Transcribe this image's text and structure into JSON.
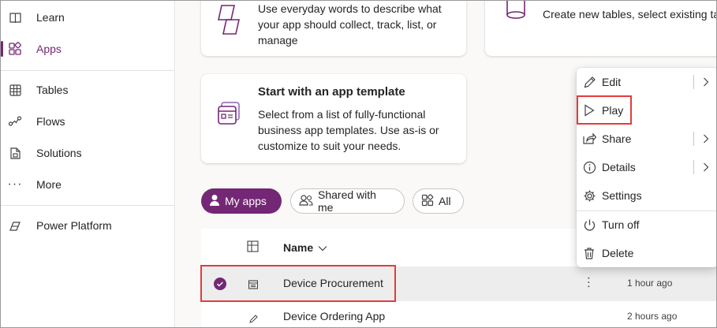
{
  "sidebar": {
    "items": [
      {
        "label": "Learn",
        "icon": "book-icon"
      },
      {
        "label": "Apps",
        "icon": "apps-icon",
        "active": true
      },
      {
        "label": "Tables",
        "icon": "table-grid-icon"
      },
      {
        "label": "Flows",
        "icon": "flow-icon"
      },
      {
        "label": "Solutions",
        "icon": "solutions-icon"
      },
      {
        "label": "More",
        "icon": "ellipsis-icon"
      },
      {
        "label": "Power Platform",
        "icon": "power-platform-icon"
      }
    ]
  },
  "cards": {
    "describe": {
      "text": "Use everyday words to describe what your app should collect, track, list, or manage"
    },
    "tables": {
      "text": "Create new tables, select existing tables, or connect to external data sources."
    },
    "template": {
      "title": "Start with an app template",
      "text": "Select from a list of fully-functional business app templates. Use as-is or customize to suit your needs."
    }
  },
  "filters": {
    "my_apps": "My apps",
    "shared": "Shared with me",
    "all": "All"
  },
  "table": {
    "name_header": "Name",
    "rows": [
      {
        "name": "Device Procurement",
        "modified": "1 hour ago",
        "selected": true
      },
      {
        "name": "Device Ordering App",
        "modified": "2 hours ago",
        "selected": false
      }
    ]
  },
  "menu": {
    "items": [
      {
        "label": "Edit",
        "submenu": true
      },
      {
        "label": "Play",
        "submenu": false
      },
      {
        "label": "Share",
        "submenu": true
      },
      {
        "label": "Details",
        "submenu": true
      },
      {
        "label": "Settings",
        "submenu": false
      },
      {
        "label": "Turn off",
        "submenu": false
      },
      {
        "label": "Delete",
        "submenu": false
      }
    ]
  },
  "colors": {
    "accent": "#742774",
    "highlight": "#e23c3c"
  }
}
